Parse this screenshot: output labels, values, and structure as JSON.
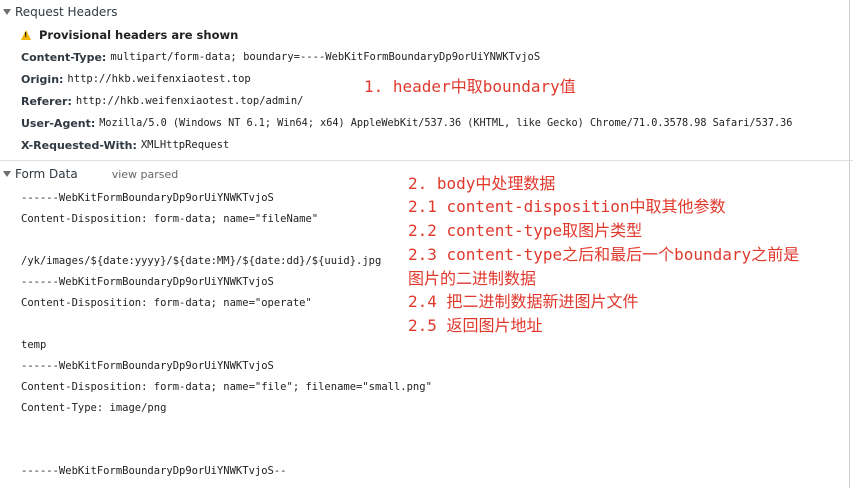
{
  "request_headers": {
    "section_title": "Request Headers",
    "warning": "Provisional headers are shown",
    "headers": [
      {
        "key": "Content-Type:",
        "value": "multipart/form-data; boundary=----WebKitFormBoundaryDp9orUiYNWKTvjoS"
      },
      {
        "key": "Origin:",
        "value": "http://hkb.weifenxiaotest.top"
      },
      {
        "key": "Referer:",
        "value": "http://hkb.weifenxiaotest.top/admin/"
      },
      {
        "key": "User-Agent:",
        "value": "Mozilla/5.0 (Windows NT 6.1; Win64; x64) AppleWebKit/537.36 (KHTML, like Gecko) Chrome/71.0.3578.98 Safari/537.36"
      },
      {
        "key": "X-Requested-With:",
        "value": "XMLHttpRequest"
      }
    ]
  },
  "form_data": {
    "section_title": "Form Data",
    "view_parsed": "view parsed",
    "lines": [
      "------WebKitFormBoundaryDp9orUiYNWKTvjoS",
      "Content-Disposition: form-data; name=\"fileName\"",
      "",
      "/yk/images/${date:yyyy}/${date:MM}/${date:dd}/${uuid}.jpg",
      "------WebKitFormBoundaryDp9orUiYNWKTvjoS",
      "Content-Disposition: form-data; name=\"operate\"",
      "",
      "temp",
      "------WebKitFormBoundaryDp9orUiYNWKTvjoS",
      "Content-Disposition: form-data; name=\"file\"; filename=\"small.png\"",
      "Content-Type: image/png",
      "",
      "",
      "",
      "------WebKitFormBoundaryDp9orUiYNWKTvjoS--"
    ]
  },
  "annotations": {
    "note1": "1. header中取boundary值",
    "steps": [
      "2. body中处理数据",
      "2.1 content-disposition中取其他参数",
      "2.2 content-type取图片类型",
      "2.3 content-type之后和最后一个boundary之前是",
      "图片的二进制数据",
      "2.4 把二进制数据新进图片文件",
      "2.5 返回图片地址"
    ]
  }
}
